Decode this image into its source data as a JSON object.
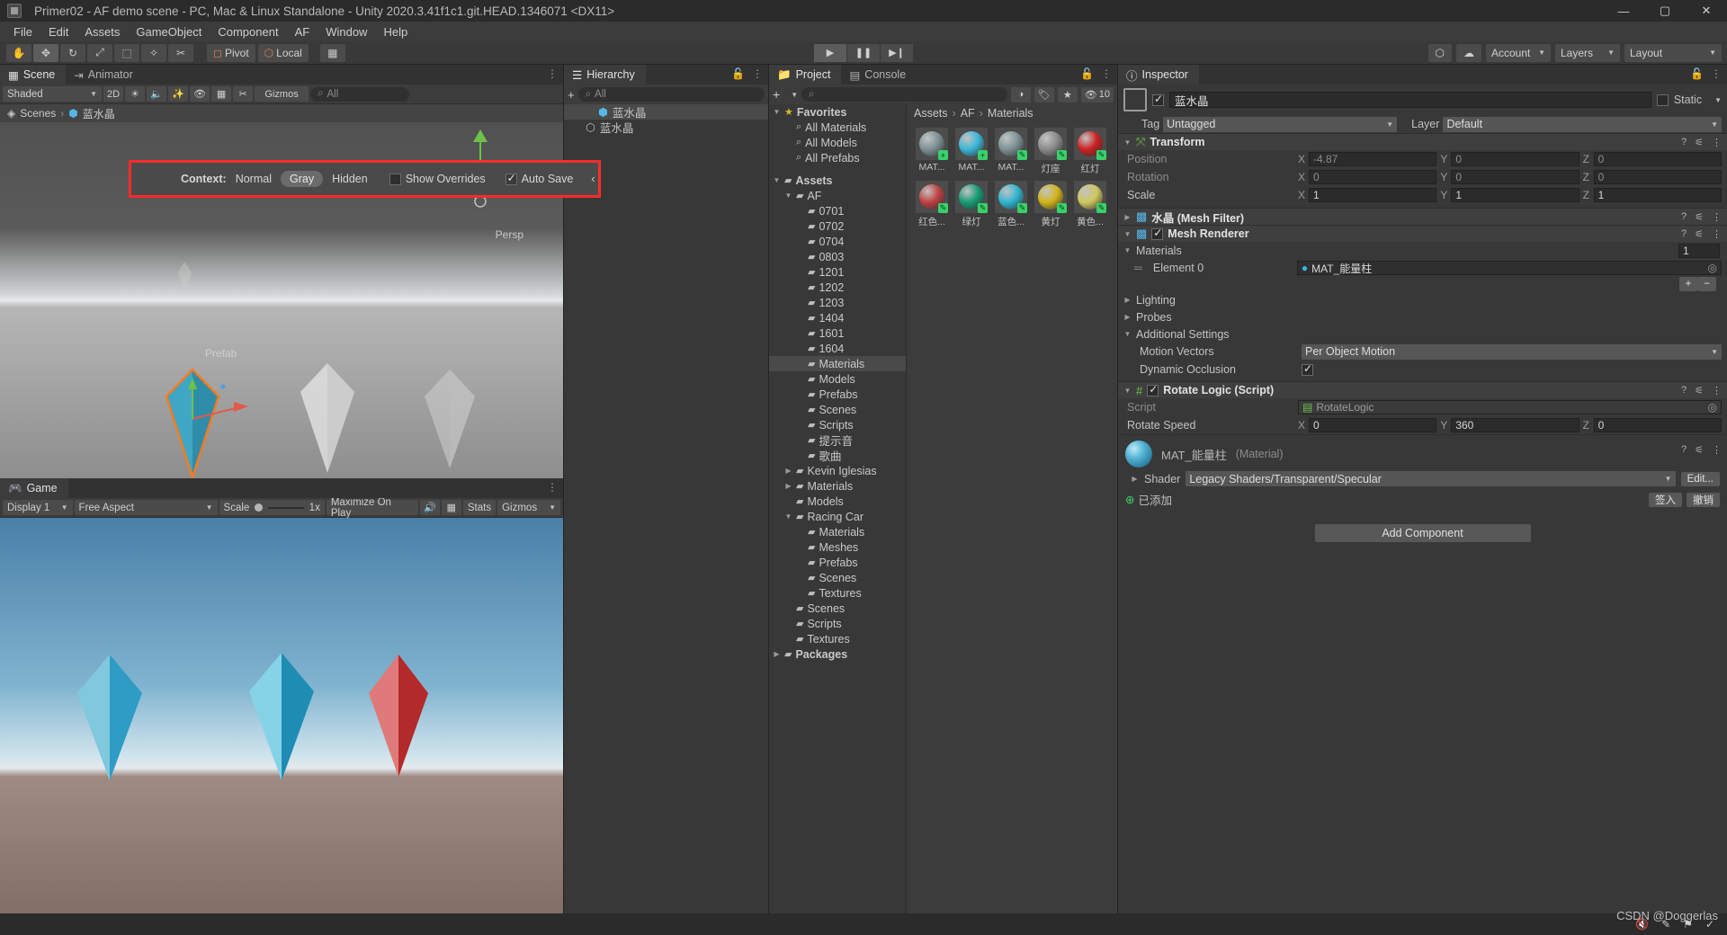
{
  "window": {
    "title": "Primer02 - AF demo scene - PC, Mac & Linux Standalone - Unity 2020.3.41f1c1.git.HEAD.1346071 <DX11>",
    "minimize": "—",
    "maximize": "▢",
    "close": "✕"
  },
  "menubar": {
    "items": [
      "File",
      "Edit",
      "Assets",
      "GameObject",
      "Component",
      "AF",
      "Window",
      "Help"
    ]
  },
  "toolbar": {
    "tools": [
      {
        "name": "hand-tool",
        "glyph": "✋"
      },
      {
        "name": "move-tool",
        "glyph": "✥"
      },
      {
        "name": "rotate-tool",
        "glyph": "↻"
      },
      {
        "name": "scale-tool",
        "glyph": "⤢"
      },
      {
        "name": "rect-tool",
        "glyph": "⬚"
      },
      {
        "name": "transform-tool",
        "glyph": "✧"
      },
      {
        "name": "custom-tool",
        "glyph": "✂"
      }
    ],
    "pivot_label": "Pivot",
    "local_label": "Local",
    "grid_glyph": "▦",
    "play": "▶",
    "pause": "❚❚",
    "step": "▶❙",
    "collab_glyph": "⬡",
    "cloud_glyph": "☁",
    "account_label": "Account",
    "layers_label": "Layers",
    "layout_label": "Layout"
  },
  "scene": {
    "tabs": [
      {
        "label": "Scene",
        "icon": "grid-icon",
        "active": true
      },
      {
        "label": "Animator",
        "icon": "animator-icon",
        "active": false
      }
    ],
    "shading_mode": "Shaded",
    "mode_2d": "2D",
    "search_placeholder": "All",
    "gizmos_label": "Gizmos",
    "breadcrumb": [
      "Scenes",
      "蓝水晶"
    ],
    "persp_label": "Persp",
    "prefab_label": "Prefab",
    "context_bar": {
      "label": "Context:",
      "options": [
        "Normal",
        "Gray",
        "Hidden"
      ],
      "selected": "Gray",
      "show_overrides_label": "Show Overrides",
      "show_overrides_checked": false,
      "auto_save_label": "Auto Save",
      "auto_save_checked": true,
      "collapse_glyph": "‹",
      "highlight_color": "#ff2b2b"
    }
  },
  "game": {
    "tab_label": "Game",
    "display_label": "Display 1",
    "aspect_label": "Free Aspect",
    "scale_label": "Scale",
    "scale_value": "1x",
    "maximize_label": "Maximize On Play",
    "mute_glyph": "🔊",
    "stats_label": "Stats",
    "gizmos_label": "Gizmos"
  },
  "hierarchy": {
    "tab_label": "Hierarchy",
    "add_glyph": "+",
    "search_placeholder": "All",
    "rows": [
      {
        "label": "蓝水晶",
        "depth": 0,
        "selected": true,
        "icon": "prefab-cube-icon"
      },
      {
        "label": "蓝水晶",
        "depth": 1,
        "selected": false,
        "icon": "cube-icon"
      }
    ]
  },
  "project": {
    "tabs": [
      {
        "label": "Project",
        "icon": "folder-icon",
        "active": true
      },
      {
        "label": "Console",
        "icon": "console-icon",
        "active": false
      }
    ],
    "add_label": "+",
    "search_placeholder": "",
    "filter_icons": [
      "type-filter-icon",
      "label-filter-icon",
      "favorite-filter-icon"
    ],
    "hidden_count": "10",
    "breadcrumb": [
      "Assets",
      "AF",
      "Materials"
    ],
    "tree": [
      {
        "label": "Favorites",
        "depth": 0,
        "arrow": "▼",
        "icon": "star-icon",
        "bold": true
      },
      {
        "label": "All Materials",
        "depth": 1,
        "arrow": "",
        "icon": "search-icon"
      },
      {
        "label": "All Models",
        "depth": 1,
        "arrow": "",
        "icon": "search-icon"
      },
      {
        "label": "All Prefabs",
        "depth": 1,
        "arrow": "",
        "icon": "search-icon"
      },
      {
        "label": "",
        "depth": 0,
        "arrow": "",
        "icon": "spacer"
      },
      {
        "label": "Assets",
        "depth": 0,
        "arrow": "▼",
        "icon": "folder-icon",
        "bold": true
      },
      {
        "label": "AF",
        "depth": 1,
        "arrow": "▼",
        "icon": "folder-icon"
      },
      {
        "label": "0701",
        "depth": 2,
        "arrow": "",
        "icon": "folder-icon"
      },
      {
        "label": "0702",
        "depth": 2,
        "arrow": "",
        "icon": "folder-icon"
      },
      {
        "label": "0704",
        "depth": 2,
        "arrow": "",
        "icon": "folder-icon"
      },
      {
        "label": "0803",
        "depth": 2,
        "arrow": "",
        "icon": "folder-icon"
      },
      {
        "label": "1201",
        "depth": 2,
        "arrow": "",
        "icon": "folder-icon"
      },
      {
        "label": "1202",
        "depth": 2,
        "arrow": "",
        "icon": "folder-icon"
      },
      {
        "label": "1203",
        "depth": 2,
        "arrow": "",
        "icon": "folder-icon"
      },
      {
        "label": "1404",
        "depth": 2,
        "arrow": "",
        "icon": "folder-icon"
      },
      {
        "label": "1601",
        "depth": 2,
        "arrow": "",
        "icon": "folder-icon"
      },
      {
        "label": "1604",
        "depth": 2,
        "arrow": "",
        "icon": "folder-icon"
      },
      {
        "label": "Materials",
        "depth": 2,
        "arrow": "",
        "icon": "folder-icon",
        "selected": true
      },
      {
        "label": "Models",
        "depth": 2,
        "arrow": "",
        "icon": "folder-icon"
      },
      {
        "label": "Prefabs",
        "depth": 2,
        "arrow": "",
        "icon": "folder-icon"
      },
      {
        "label": "Scenes",
        "depth": 2,
        "arrow": "",
        "icon": "folder-icon"
      },
      {
        "label": "Scripts",
        "depth": 2,
        "arrow": "",
        "icon": "folder-icon"
      },
      {
        "label": "提示音",
        "depth": 2,
        "arrow": "",
        "icon": "folder-icon"
      },
      {
        "label": "歌曲",
        "depth": 2,
        "arrow": "",
        "icon": "folder-icon"
      },
      {
        "label": "Kevin Iglesias",
        "depth": 1,
        "arrow": "▶",
        "icon": "folder-icon"
      },
      {
        "label": "Materials",
        "depth": 1,
        "arrow": "▶",
        "icon": "folder-icon"
      },
      {
        "label": "Models",
        "depth": 1,
        "arrow": "",
        "icon": "folder-icon"
      },
      {
        "label": "Racing Car",
        "depth": 1,
        "arrow": "▼",
        "icon": "folder-icon"
      },
      {
        "label": "Materials",
        "depth": 2,
        "arrow": "",
        "icon": "folder-icon"
      },
      {
        "label": "Meshes",
        "depth": 2,
        "arrow": "",
        "icon": "folder-icon"
      },
      {
        "label": "Prefabs",
        "depth": 2,
        "arrow": "",
        "icon": "folder-icon"
      },
      {
        "label": "Scenes",
        "depth": 2,
        "arrow": "",
        "icon": "folder-icon"
      },
      {
        "label": "Textures",
        "depth": 2,
        "arrow": "",
        "icon": "folder-icon"
      },
      {
        "label": "Scenes",
        "depth": 1,
        "arrow": "",
        "icon": "folder-icon"
      },
      {
        "label": "Scripts",
        "depth": 1,
        "arrow": "",
        "icon": "folder-icon"
      },
      {
        "label": "Textures",
        "depth": 1,
        "arrow": "",
        "icon": "folder-icon"
      },
      {
        "label": "Packages",
        "depth": 0,
        "arrow": "▶",
        "icon": "folder-icon",
        "bold": true
      }
    ],
    "assets": [
      {
        "name": "MAT...",
        "color": "#7d9196",
        "badge": "+"
      },
      {
        "name": "MAT...",
        "color": "#3ab6d8",
        "badge": "+"
      },
      {
        "name": "MAT...",
        "color": "#7d9196",
        "badge": "✎"
      },
      {
        "name": "灯座",
        "color": "#8a8a8a",
        "badge": "✎"
      },
      {
        "name": "红灯",
        "color": "#cc2020",
        "badge": "✎"
      },
      {
        "name": "红色...",
        "color": "#c04040",
        "badge": "✎"
      },
      {
        "name": "绿灯",
        "color": "#159c72",
        "badge": "✎"
      },
      {
        "name": "蓝色...",
        "color": "#2eb5cf",
        "badge": "✎"
      },
      {
        "name": "黄灯",
        "color": "#d2b41a",
        "badge": "✎"
      },
      {
        "name": "黄色...",
        "color": "#cfc75e",
        "badge": "✎"
      }
    ]
  },
  "inspector": {
    "tab_label": "Inspector",
    "object_name": "蓝水晶",
    "object_enabled": true,
    "static_label": "Static",
    "static_checked": false,
    "tag_label": "Tag",
    "tag_value": "Untagged",
    "layer_label": "Layer",
    "layer_value": "Default",
    "transform": {
      "title": "Transform",
      "rows": [
        {
          "name": "Position",
          "dim": true,
          "x": "-4.87",
          "y": "0",
          "z": "0"
        },
        {
          "name": "Rotation",
          "dim": true,
          "x": "0",
          "y": "0",
          "z": "0"
        },
        {
          "name": "Scale",
          "dim": false,
          "x": "1",
          "y": "1",
          "z": "1"
        }
      ]
    },
    "mesh_filter": {
      "title": "水晶 (Mesh Filter)",
      "collapsed": true
    },
    "mesh_renderer": {
      "title": "Mesh Renderer",
      "enabled": true,
      "materials_label": "Materials",
      "materials_count": "1",
      "element_label": "Element 0",
      "element_value": "MAT_能量柱",
      "add_glyph": "+",
      "remove_glyph": "−",
      "lighting_label": "Lighting",
      "probes_label": "Probes",
      "additional_settings_label": "Additional Settings",
      "motion_vectors_label": "Motion Vectors",
      "motion_vectors_value": "Per Object Motion",
      "dynamic_occlusion_label": "Dynamic Occlusion",
      "dynamic_occlusion_checked": true
    },
    "script_component": {
      "title": "Rotate Logic (Script)",
      "enabled": true,
      "script_label": "Script",
      "script_value": "RotateLogic",
      "rotate_speed_label": "Rotate Speed",
      "rotate_speed_x": "0",
      "rotate_speed_y": "360",
      "rotate_speed_z": "0"
    },
    "material": {
      "title": "MAT_能量柱",
      "suffix": "(Material)",
      "shader_label": "Shader",
      "shader_value": "Legacy Shaders/Transparent/Specular",
      "edit_label": "Edit...",
      "added_label": "已添加",
      "checkin_label": "签入",
      "revert_label": "撤销"
    },
    "add_component_label": "Add Component"
  },
  "statusbar": {
    "watermark": "CSDN @Doggerlas"
  }
}
